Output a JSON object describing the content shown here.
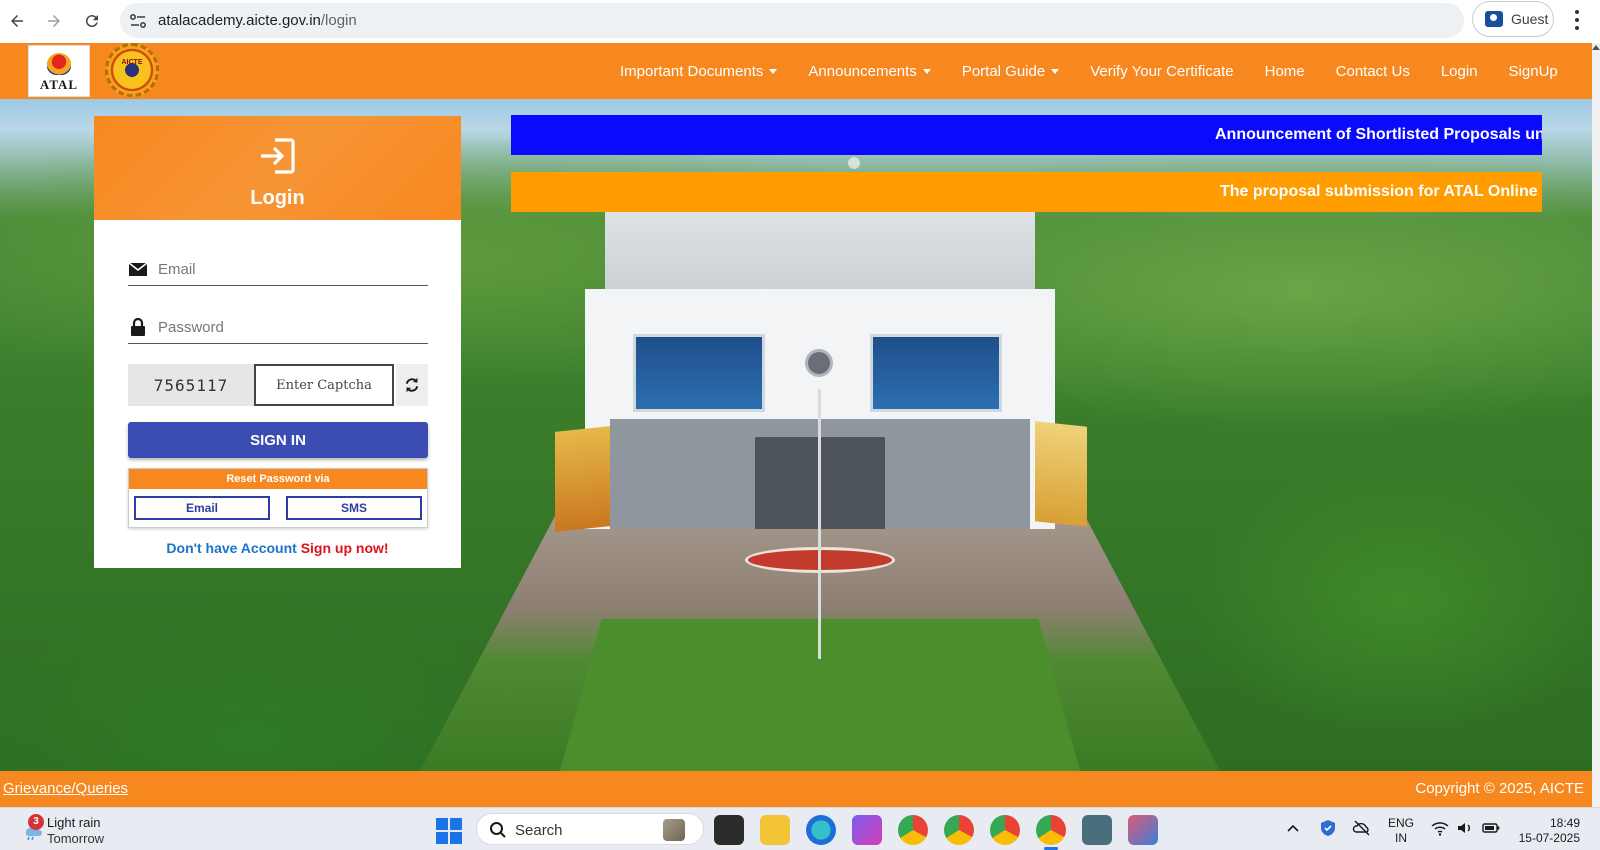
{
  "browser": {
    "url_domain": "atalacademy.aicte.gov.in",
    "url_path": "/login",
    "profile_label": "Guest"
  },
  "header": {
    "logo_atal_text": "ATAL",
    "logo_aicte_text": "AICTE",
    "nav": [
      {
        "label": "Important Documents",
        "dropdown": true
      },
      {
        "label": "Announcements",
        "dropdown": true
      },
      {
        "label": "Portal Guide",
        "dropdown": true
      },
      {
        "label": "Verify Your Certificate",
        "dropdown": false
      },
      {
        "label": "Home",
        "dropdown": false
      },
      {
        "label": "Contact Us",
        "dropdown": false
      },
      {
        "label": "Login",
        "dropdown": false
      },
      {
        "label": "SignUp",
        "dropdown": false
      }
    ]
  },
  "login": {
    "title": "Login",
    "email_placeholder": "Email",
    "password_placeholder": "Password",
    "captcha_code": "7565117",
    "captcha_placeholder": "Enter Captcha",
    "signin_label": "SIGN IN",
    "reset_heading": "Reset Password via",
    "reset_email_label": "Email",
    "reset_sms_label": "SMS",
    "signup_question": "Don't have Account",
    "signup_link": "Sign up now!"
  },
  "tickers": {
    "announcement_1": "Announcement of Shortlisted Proposals unde",
    "announcement_2": "The proposal submission for ATAL Online FD"
  },
  "footer": {
    "grievance_link": "Grievance/Queries",
    "copyright": "Copyright © 2025, AICTE"
  },
  "taskbar": {
    "weather_badge": "3",
    "weather_line1": "Light rain",
    "weather_line2": "Tomorrow",
    "search_label": "Search",
    "lang_line1": "ENG",
    "lang_line2": "IN",
    "time": "18:49",
    "date": "15-07-2025"
  },
  "colors": {
    "brand_orange": "#f7881f",
    "ticker_blue": "#0a0aff",
    "ticker_orange": "#ff9d00",
    "signin_blue": "#3b4db3",
    "signup_red": "#e0101a",
    "signup_question_blue": "#1a73c8"
  },
  "icons": [
    "back-arrow-icon",
    "forward-arrow-icon",
    "reload-icon",
    "site-info-icon",
    "profile-icon",
    "more-vert-icon",
    "login-icon",
    "email-icon",
    "lock-icon",
    "refresh-icon",
    "weather-icon",
    "windows-start-icon",
    "search-icon"
  ]
}
